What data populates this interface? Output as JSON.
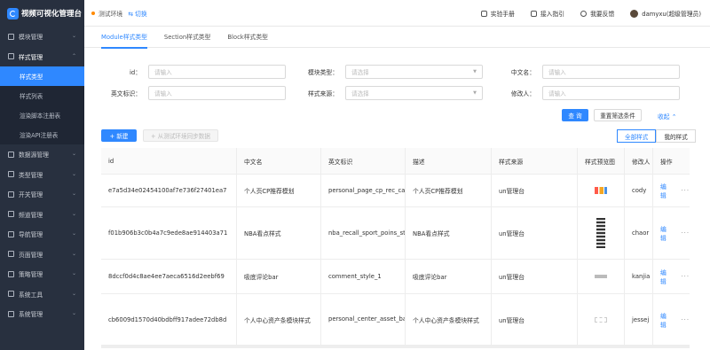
{
  "app": {
    "title": "视频可视化管理台"
  },
  "topbar": {
    "env_label": "测试环境",
    "switch_label": "⇆ 切换",
    "links": [
      "实验手册",
      "接入指引",
      "我要反馈"
    ],
    "user": "damyxu(超级管理员)"
  },
  "sidebar": {
    "items_top": [
      {
        "label": "模块管理",
        "chevron": "⌄"
      },
      {
        "label": "样式管理",
        "chevron": "⌃"
      }
    ],
    "sub_items": [
      "样式类型",
      "样式列表",
      "渲染脚本注册表",
      "渲染API注册表"
    ],
    "items_bottom": [
      {
        "label": "数据源管理",
        "chevron": "⌄"
      },
      {
        "label": "类型管理",
        "chevron": "⌄"
      },
      {
        "label": "开关管理",
        "chevron": "⌄"
      },
      {
        "label": "频道管理",
        "chevron": "⌄"
      },
      {
        "label": "导航管理",
        "chevron": "⌄"
      },
      {
        "label": "页面管理",
        "chevron": "⌄"
      },
      {
        "label": "策略管理",
        "chevron": "⌄"
      },
      {
        "label": "系统工具",
        "chevron": "⌄"
      },
      {
        "label": "系统管理",
        "chevron": "⌄"
      }
    ]
  },
  "tabs": [
    "Module样式类型",
    "Section样式类型",
    "Block样式类型"
  ],
  "filters": {
    "id": {
      "label": "id：",
      "placeholder": "请输入"
    },
    "module_type": {
      "label": "模块类型：",
      "placeholder": "请选择"
    },
    "cn_name": {
      "label": "中文名：",
      "placeholder": "请输入"
    },
    "en_id": {
      "label": "英文标识：",
      "placeholder": "请输入"
    },
    "style_source": {
      "label": "样式来源：",
      "placeholder": "请选择"
    },
    "modifier": {
      "label": "修改人：",
      "placeholder": "请输入"
    }
  },
  "actions": {
    "query": "查 询",
    "reset": "重置筛选条件",
    "collapse": "收起 ⌃",
    "new": "+ 新建",
    "sync": "+ 从测试环境同步数据",
    "all_styles": "全部样式",
    "my_styles": "我的样式"
  },
  "table": {
    "headers": [
      "id",
      "中文名",
      "英文标识",
      "描述",
      "样式来源",
      "样式预览图",
      "修改人",
      "操作"
    ],
    "rows": [
      {
        "id": "e7a5d34e02454100af7e736f27401ea7",
        "cn": "个人页CP推荐模划",
        "en": "personal_page_cp_rec_card",
        "desc": "个人页CP推荐模划",
        "source": "un管理台",
        "preview": "th1",
        "modifier": "cody",
        "edit": "编辑",
        "more": "···"
      },
      {
        "id": "f01b906b3c0b4a7c9ede8ae914403a71",
        "cn": "NBA看点样式",
        "en": "nba_recall_sport_poins_style",
        "desc": "NBA看点样式",
        "source": "un管理台",
        "preview": "th2",
        "modifier": "chaor",
        "edit": "编辑",
        "more": "···"
      },
      {
        "id": "8dccf0d4c8ae4ee7aeca6516d2eebf69",
        "cn": "吸底评论bar",
        "en": "comment_style_1",
        "desc": "吸底评论bar",
        "source": "un管理台",
        "preview": "th3",
        "modifier": "kanjia",
        "edit": "编辑",
        "more": "···"
      },
      {
        "id": "cb6009d1570d40bdbff917adee72db8d",
        "cn": "个人中心资产条模块样式",
        "en": "personal_center_asset_bar_module",
        "desc": "个人中心资产条模块样式",
        "source": "un管理台",
        "preview": "th4",
        "modifier": "jessej",
        "edit": "编辑",
        "more": "···"
      }
    ]
  }
}
